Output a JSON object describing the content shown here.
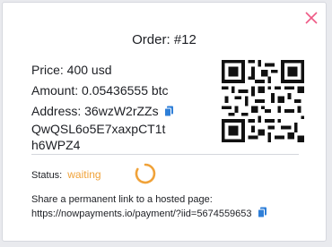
{
  "modal": {
    "title": "Order: #12",
    "price": "Price: 400 usd",
    "amount": "Amount: 0.05436555 btc",
    "address_line1": "Address: 36wzW2rZZs",
    "address_line2": "QwQSL6o5E7xaxpCT1t",
    "address_line3": "h6WPZ4",
    "status_label": "Status:",
    "status_value": "waiting",
    "share_text": "Share a permanent link to a hosted page:",
    "share_link": "https://nowpayments.io/payment/?iid=5674559653"
  },
  "icons": {
    "close": "close-icon",
    "copy": "copy-icon",
    "qr": "qr-code-icon",
    "spinner": "loading-spinner-icon"
  },
  "colors": {
    "accent_blue": "#2f7fd8",
    "close_pink": "#ee5a86",
    "status_orange": "#f0a239"
  }
}
